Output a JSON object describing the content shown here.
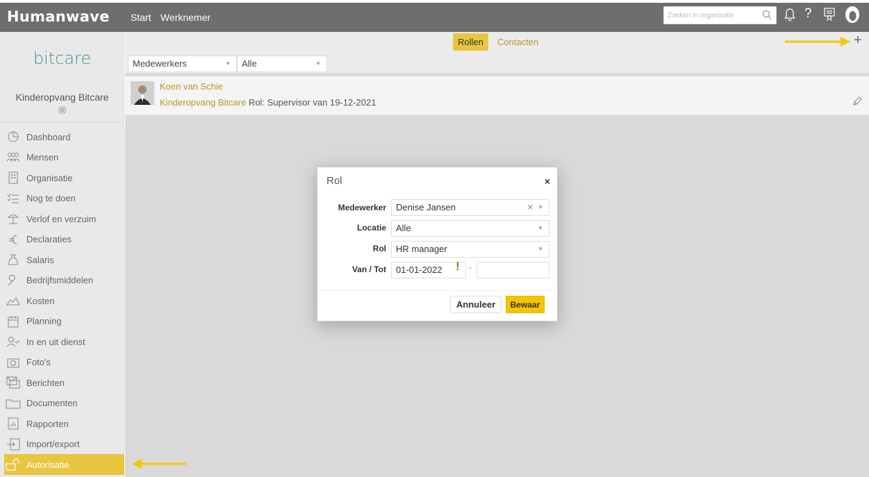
{
  "header": {
    "logo": "Humanwave",
    "nav": [
      "Start",
      "Werknemer"
    ],
    "search_placeholder": "Zoeken in organisatie",
    "help_label": "?"
  },
  "sidebar": {
    "brand": "bitcare",
    "org_name": "Kinderopvang Bitcare",
    "items": [
      {
        "label": "Dashboard",
        "icon": "dashboard-icon"
      },
      {
        "label": "Mensen",
        "icon": "people-icon"
      },
      {
        "label": "Organisatie",
        "icon": "building-icon"
      },
      {
        "label": "Nog te doen",
        "icon": "checklist-icon"
      },
      {
        "label": "Verlof en verzuim",
        "icon": "beach-icon"
      },
      {
        "label": "Declaraties",
        "icon": "euro-icon"
      },
      {
        "label": "Salaris",
        "icon": "money-bag-icon"
      },
      {
        "label": "Bedrijfsmiddelen",
        "icon": "wrench-icon"
      },
      {
        "label": "Kosten",
        "icon": "chart-icon"
      },
      {
        "label": "Planning",
        "icon": "calendar-icon"
      },
      {
        "label": "In en uit dienst",
        "icon": "person-check-icon"
      },
      {
        "label": "Foto's",
        "icon": "camera-icon"
      },
      {
        "label": "Berichten",
        "icon": "messages-icon"
      },
      {
        "label": "Documenten",
        "icon": "folder-icon"
      },
      {
        "label": "Rapporten",
        "icon": "report-icon"
      },
      {
        "label": "Import/export",
        "icon": "import-export-icon"
      },
      {
        "label": "Autorisatie",
        "icon": "unlock-icon",
        "active": true
      }
    ]
  },
  "tabs": {
    "rollen": "Rollen",
    "contacten": "Contacten",
    "add": "+"
  },
  "filters": {
    "type": "Medewerkers",
    "scope": "Alle"
  },
  "role_row": {
    "name": "Koen van Schie",
    "org": "Kinderopvang Bitcare",
    "detail": " Rol: Supervisor van 19-12-2021"
  },
  "modal": {
    "title": "Rol",
    "close": "×",
    "labels": {
      "medewerker": "Medewerker",
      "locatie": "Locatie",
      "rol": "Rol",
      "van_tot": "Van / Tot"
    },
    "values": {
      "medewerker": "Denise Jansen",
      "locatie": "Alle",
      "rol": "HR manager",
      "van": "01-01-2022",
      "tot": ""
    },
    "warning": "!",
    "separator": "-",
    "cancel": "Annuleer",
    "save": "Bewaar"
  },
  "colors": {
    "accent": "#e8c640",
    "link": "#b8962a",
    "topbar": "#6e6e6e",
    "brand": "#4a8f8e",
    "save": "#f5c400"
  }
}
